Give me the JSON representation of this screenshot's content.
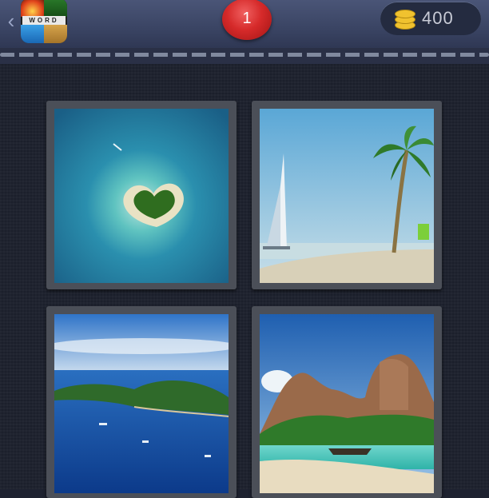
{
  "header": {
    "level": "1",
    "coins": "400",
    "logo_letters": "WORD"
  },
  "icons": {
    "back": "chevron-left-icon",
    "coins": "coin-stack-icon",
    "logo": "app-logo-icon"
  },
  "colors": {
    "badge": "#d62a2a",
    "coin": "#f0c22f",
    "background": "#1b1f2b"
  },
  "pictures": [
    {
      "name": "heart-shaped-island"
    },
    {
      "name": "sailboat-palm-beach"
    },
    {
      "name": "island-bay-with-boats"
    },
    {
      "name": "tropical-cliffs-longtail-boat"
    }
  ]
}
